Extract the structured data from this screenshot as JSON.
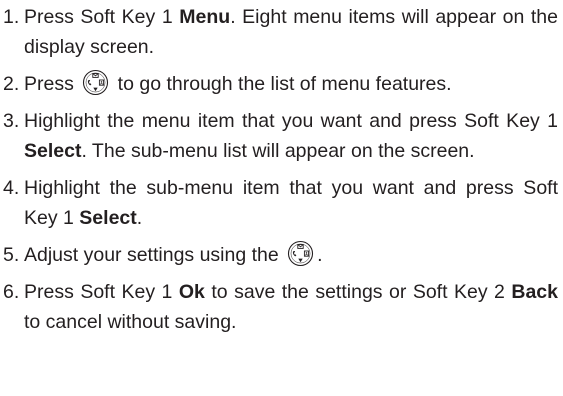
{
  "steps": [
    {
      "number": "1.",
      "parts": [
        {
          "type": "text",
          "value": "Press Soft Key 1 "
        },
        {
          "type": "bold",
          "value": "Menu"
        },
        {
          "type": "text",
          "value": ". Eight menu items will appear on the display screen."
        }
      ]
    },
    {
      "number": "2.",
      "parts": [
        {
          "type": "text",
          "value": "Press "
        },
        {
          "type": "icon",
          "value": "navigation-key-icon"
        },
        {
          "type": "text",
          "value": " to go through the list of menu features."
        }
      ]
    },
    {
      "number": "3.",
      "parts": [
        {
          "type": "text",
          "value": "Highlight the menu item that you want and press Soft Key 1 "
        },
        {
          "type": "bold",
          "value": "Select"
        },
        {
          "type": "text",
          "value": ". The sub-menu list will appear on the screen."
        }
      ]
    },
    {
      "number": "4.",
      "parts": [
        {
          "type": "text",
          "value": "Highlight the sub-menu item that you want and press Soft Key 1 "
        },
        {
          "type": "bold",
          "value": "Select"
        },
        {
          "type": "text",
          "value": "."
        }
      ]
    },
    {
      "number": "5.",
      "parts": [
        {
          "type": "text",
          "value": "Adjust your settings using the "
        },
        {
          "type": "icon",
          "value": "navigation-key-icon"
        },
        {
          "type": "text",
          "value": "."
        }
      ]
    },
    {
      "number": "6.",
      "parts": [
        {
          "type": "text",
          "value": "Press Soft Key 1 "
        },
        {
          "type": "bold",
          "value": "Ok"
        },
        {
          "type": "text",
          "value": " to save the settings or Soft Key 2 "
        },
        {
          "type": "bold",
          "value": "Back"
        },
        {
          "type": "text",
          "value": " to cancel without saving."
        }
      ]
    }
  ],
  "colors": {
    "text": "#231f20",
    "icon_stroke": "#231f20"
  }
}
